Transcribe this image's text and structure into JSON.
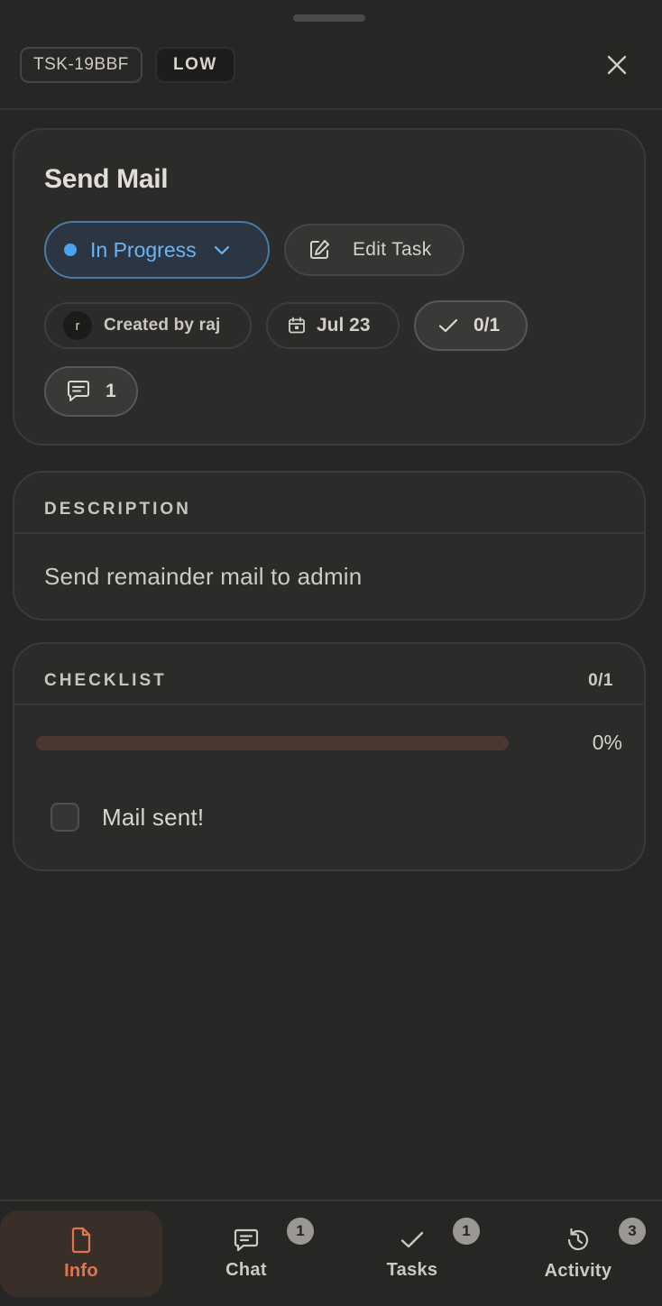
{
  "header": {
    "task_id": "TSK-19BBF",
    "priority": "LOW"
  },
  "task": {
    "title": "Send Mail",
    "status": "In Progress",
    "edit_label": "Edit Task",
    "creator_initial": "r",
    "created_by": "Created by raj",
    "due_date": "Jul 23",
    "checklist_summary": "0/1",
    "comment_count": "1"
  },
  "description": {
    "label": "DESCRIPTION",
    "text": "Send remainder mail to admin"
  },
  "checklist": {
    "label": "CHECKLIST",
    "count": "0/1",
    "progress_percent": 0,
    "progress_text": "0%",
    "items": [
      {
        "label": "Mail sent!",
        "checked": false
      }
    ]
  },
  "nav": {
    "items": [
      {
        "label": "Info",
        "badge": ""
      },
      {
        "label": "Chat",
        "badge": "1"
      },
      {
        "label": "Tasks",
        "badge": "1"
      },
      {
        "label": "Activity",
        "badge": "3"
      }
    ]
  },
  "colors": {
    "accent": "#e07a52",
    "status_blue": "#4aa3f0",
    "background": "#262625"
  },
  "icons": {
    "close": "close-icon",
    "status_dropdown": "chevron-down-icon",
    "edit": "pencil-icon",
    "date": "calendar-icon",
    "checks": "check-icon",
    "comments": "comment-icon",
    "nav_info": "document-icon",
    "nav_chat": "chat-icon",
    "nav_tasks": "check-icon",
    "nav_activity": "history-icon"
  }
}
